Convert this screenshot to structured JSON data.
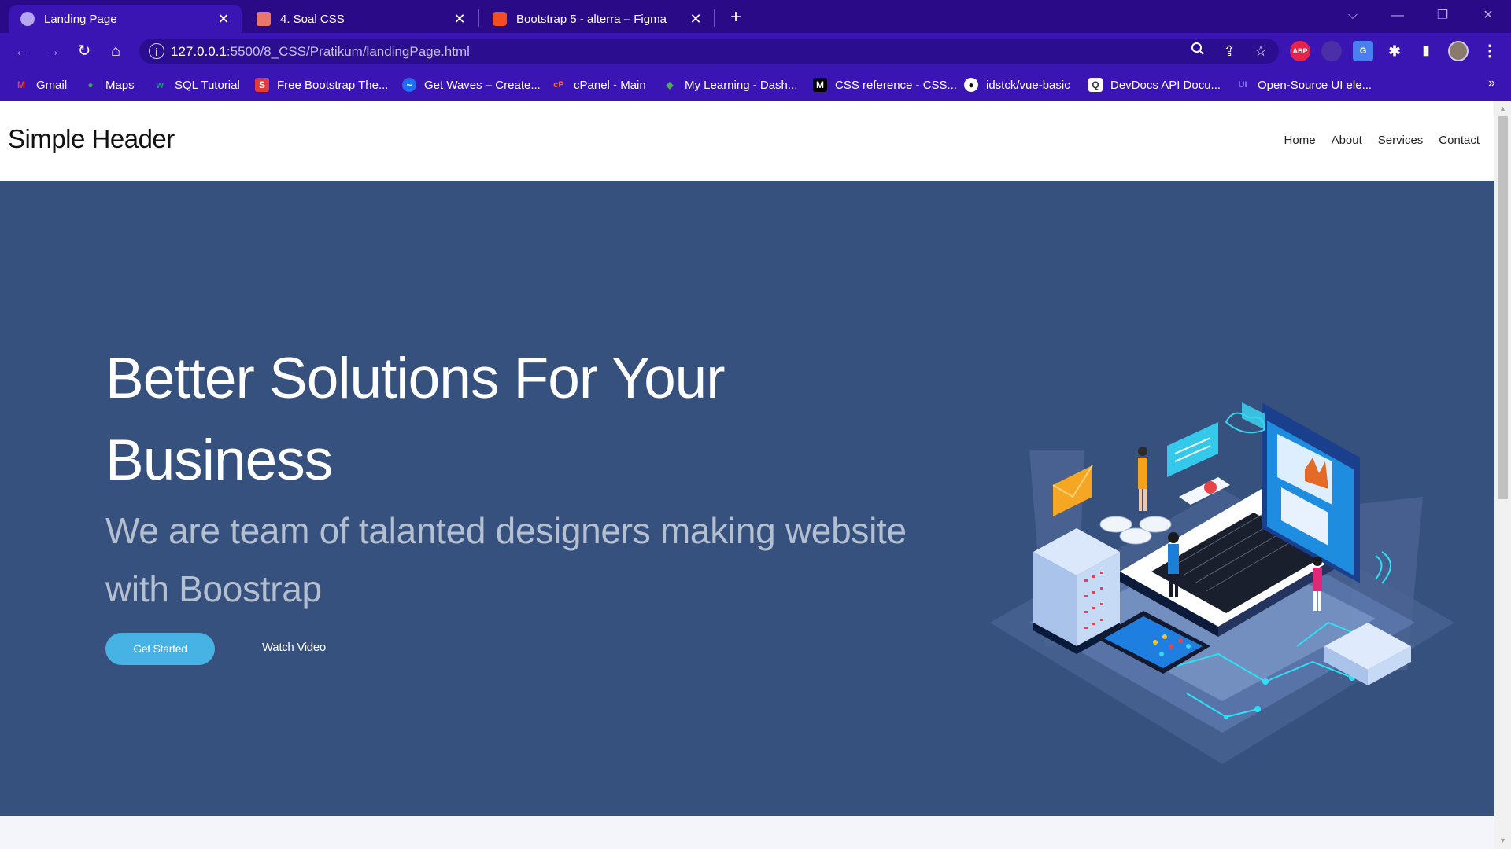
{
  "browser": {
    "tabs": [
      {
        "title": "Landing Page",
        "favicon_color": "#b4a6f0",
        "active": true
      },
      {
        "title": "4. Soal CSS",
        "favicon_color": "#e9766b",
        "active": false
      },
      {
        "title": "Bootstrap 5 - alterra – Figma",
        "favicon_color": "#f24e1e",
        "active": false
      }
    ],
    "tab_close_glyph": "✕",
    "new_tab_glyph": "+",
    "window_controls": {
      "tab_search": "⌵",
      "minimize": "—",
      "restore": "❐",
      "close": "✕"
    },
    "nav": {
      "back": "←",
      "forward": "→",
      "reload": "↻",
      "home": "⌂"
    },
    "address": {
      "host": "127.0.0.1",
      "path": ":5500/8_CSS/Pratikum/landingPage.html",
      "info_glyph": "i"
    },
    "omnibox_icons": {
      "zoom": "🔍",
      "share": "⇪",
      "bookmark_star": "☆"
    },
    "extensions": [
      {
        "name": "adblock-plus-icon",
        "label": "ABP",
        "color": "#e8234a"
      },
      {
        "name": "extension-dark-icon",
        "label": "",
        "color": "#4a2fa8"
      },
      {
        "name": "google-translate-icon",
        "label": "G",
        "color": "#4a7ff0"
      },
      {
        "name": "puzzle-extensions-icon",
        "label": "✱",
        "color": "#3b14b4"
      },
      {
        "name": "side-panel-icon",
        "label": "▮",
        "color": "#3b14b4"
      },
      {
        "name": "profile-avatar-icon",
        "label": "",
        "color": "#8a7a6a"
      },
      {
        "name": "menu-kebab-icon",
        "label": "⋮",
        "color": "#3b14b4"
      }
    ],
    "bookmarks": [
      {
        "label": "Gmail",
        "icon_text": "M",
        "icon_color": "#ea4335"
      },
      {
        "label": "Maps",
        "icon_text": "●",
        "icon_color": "#34a853"
      },
      {
        "label": "SQL Tutorial",
        "icon_text": "w",
        "icon_color": "#04aa6d"
      },
      {
        "label": "Free Bootstrap The...",
        "icon_text": "S",
        "icon_color": "#e53935"
      },
      {
        "label": "Get Waves – Create...",
        "icon_text": "~",
        "icon_color": "#1e6ef0"
      },
      {
        "label": "cPanel - Main",
        "icon_text": "cP",
        "icon_color": "#ff6c2c"
      },
      {
        "label": "My Learning - Dash...",
        "icon_text": "◆",
        "icon_color": "#4caf50"
      },
      {
        "label": "CSS reference - CSS...",
        "icon_text": "M",
        "icon_color": "#000000"
      },
      {
        "label": "idstck/vue-basic",
        "icon_text": "●",
        "icon_color": "#ffffff"
      },
      {
        "label": "DevDocs API Docu...",
        "icon_text": "Q",
        "icon_color": "#ffffff"
      },
      {
        "label": "Open-Source UI ele...",
        "icon_text": "UI",
        "icon_color": "#6b5cff"
      }
    ],
    "bookmarks_more": "»"
  },
  "site": {
    "brand": "Simple Header",
    "nav": [
      "Home",
      "About",
      "Services",
      "Contact"
    ],
    "hero": {
      "title": "Better Solutions For Your Business",
      "subtitle": "We are team of talanted designers making website with Boostrap",
      "cta_primary": "Get Started",
      "cta_secondary": "Watch Video"
    },
    "colors": {
      "hero_bg": "#37517e",
      "accent": "#47b2e4",
      "subtitle": "#b4bfd0"
    }
  },
  "scrollbar": {
    "up": "▲",
    "down": "▼"
  }
}
